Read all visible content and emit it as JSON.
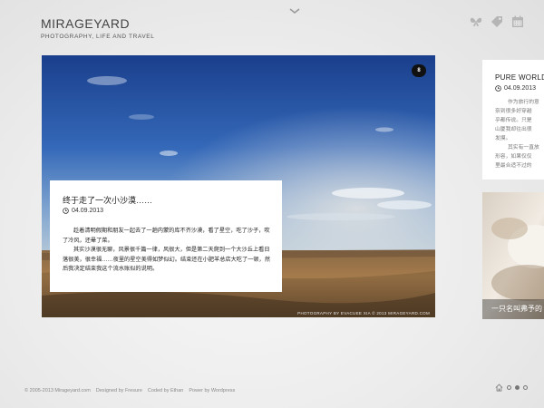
{
  "site": {
    "title": "MIRAGEYARD",
    "tagline": "PHOTOGRAPHY, LIFE AND TRAVEL"
  },
  "header_icons": [
    "butterfly-icon",
    "tag-icon",
    "calendar-icon"
  ],
  "main_post": {
    "badge": "8",
    "title": "终于走了一次小沙漠……",
    "date": "04.09.2013",
    "body": [
      "趁着清明假期和朋友一起去了一趟内蒙的库不齐沙漠，看了星空，吃了沙子，吹了冷风，还晕了菜。",
      "其实沙漠很无聊，风景很千篇一律，风很大，但是第二天爬到一个大沙丘上看日落很美，很幸福……夜里的星空美得如梦似幻。结束还在小肥羊总店大吃了一顿，然后我决定结束我这个流水账似的说明。"
    ],
    "credit": "PHOTOGRAPHY BY EVACUEE XIA © 2013 MIRAGEYARD.COM"
  },
  "side_post": {
    "title": "PURE WORLD",
    "date": "04.09.2013",
    "body_lines": [
      "作为旅行的意",
      "奈到很多好穿越",
      "乎都传说。只是",
      "山厦我却往出很",
      "发摸。",
      "其实有一直放",
      "形容，如果仅仅",
      "里最合适不过的"
    ]
  },
  "side_post_2": {
    "caption": "一只名叫弗予的"
  },
  "footer": {
    "items": [
      "© 2005-2013 Mirageyard.com",
      "Designed by Fresure",
      "Coded by Ethan",
      "Power by Wordpress"
    ]
  },
  "pager": {
    "pages": 3,
    "active_index": 1
  }
}
